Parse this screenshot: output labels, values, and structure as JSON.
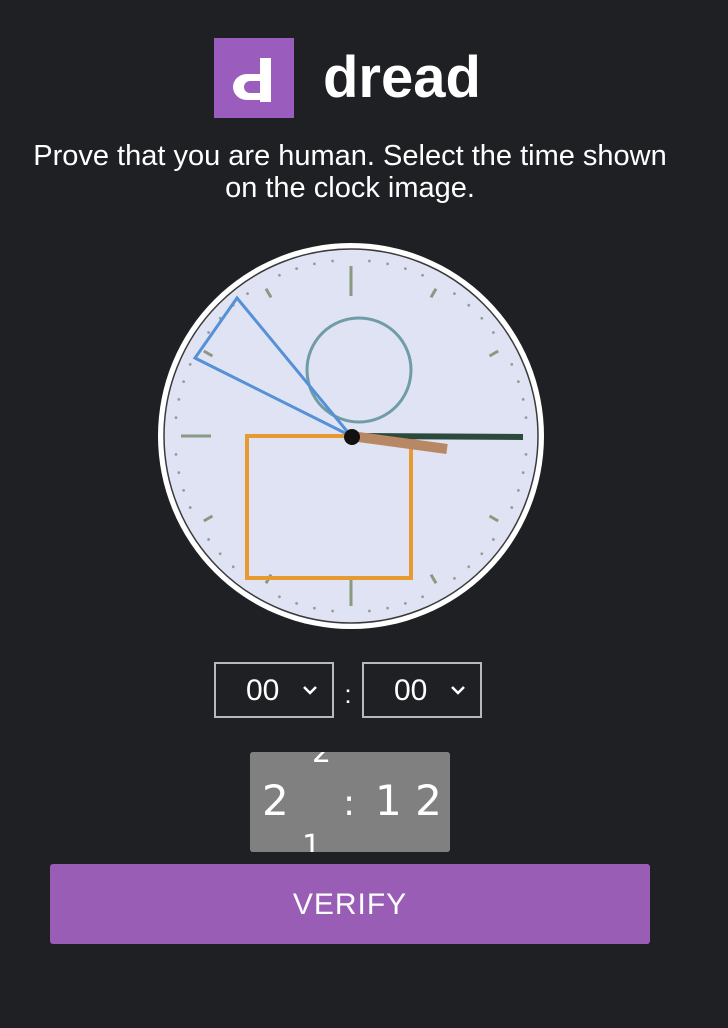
{
  "brand": {
    "logo_letter": "d",
    "name": "dread",
    "accent_color": "#9a5dbe"
  },
  "instructions": "Prove that you are human. Select the time shown on the clock image.",
  "time_select": {
    "hour_value": "00",
    "separator": ":",
    "minute_value": "00"
  },
  "captcha_text": {
    "main_left": "2",
    "sep": ":",
    "main_right": "1 2",
    "fragment_top": "2",
    "fragment_bottom": "1"
  },
  "verify_label": "VERIFY",
  "colors": {
    "background": "#1f2024",
    "clock_face": "#dfe3f4",
    "button": "#9a5db6",
    "captcha_bg": "#808080"
  }
}
